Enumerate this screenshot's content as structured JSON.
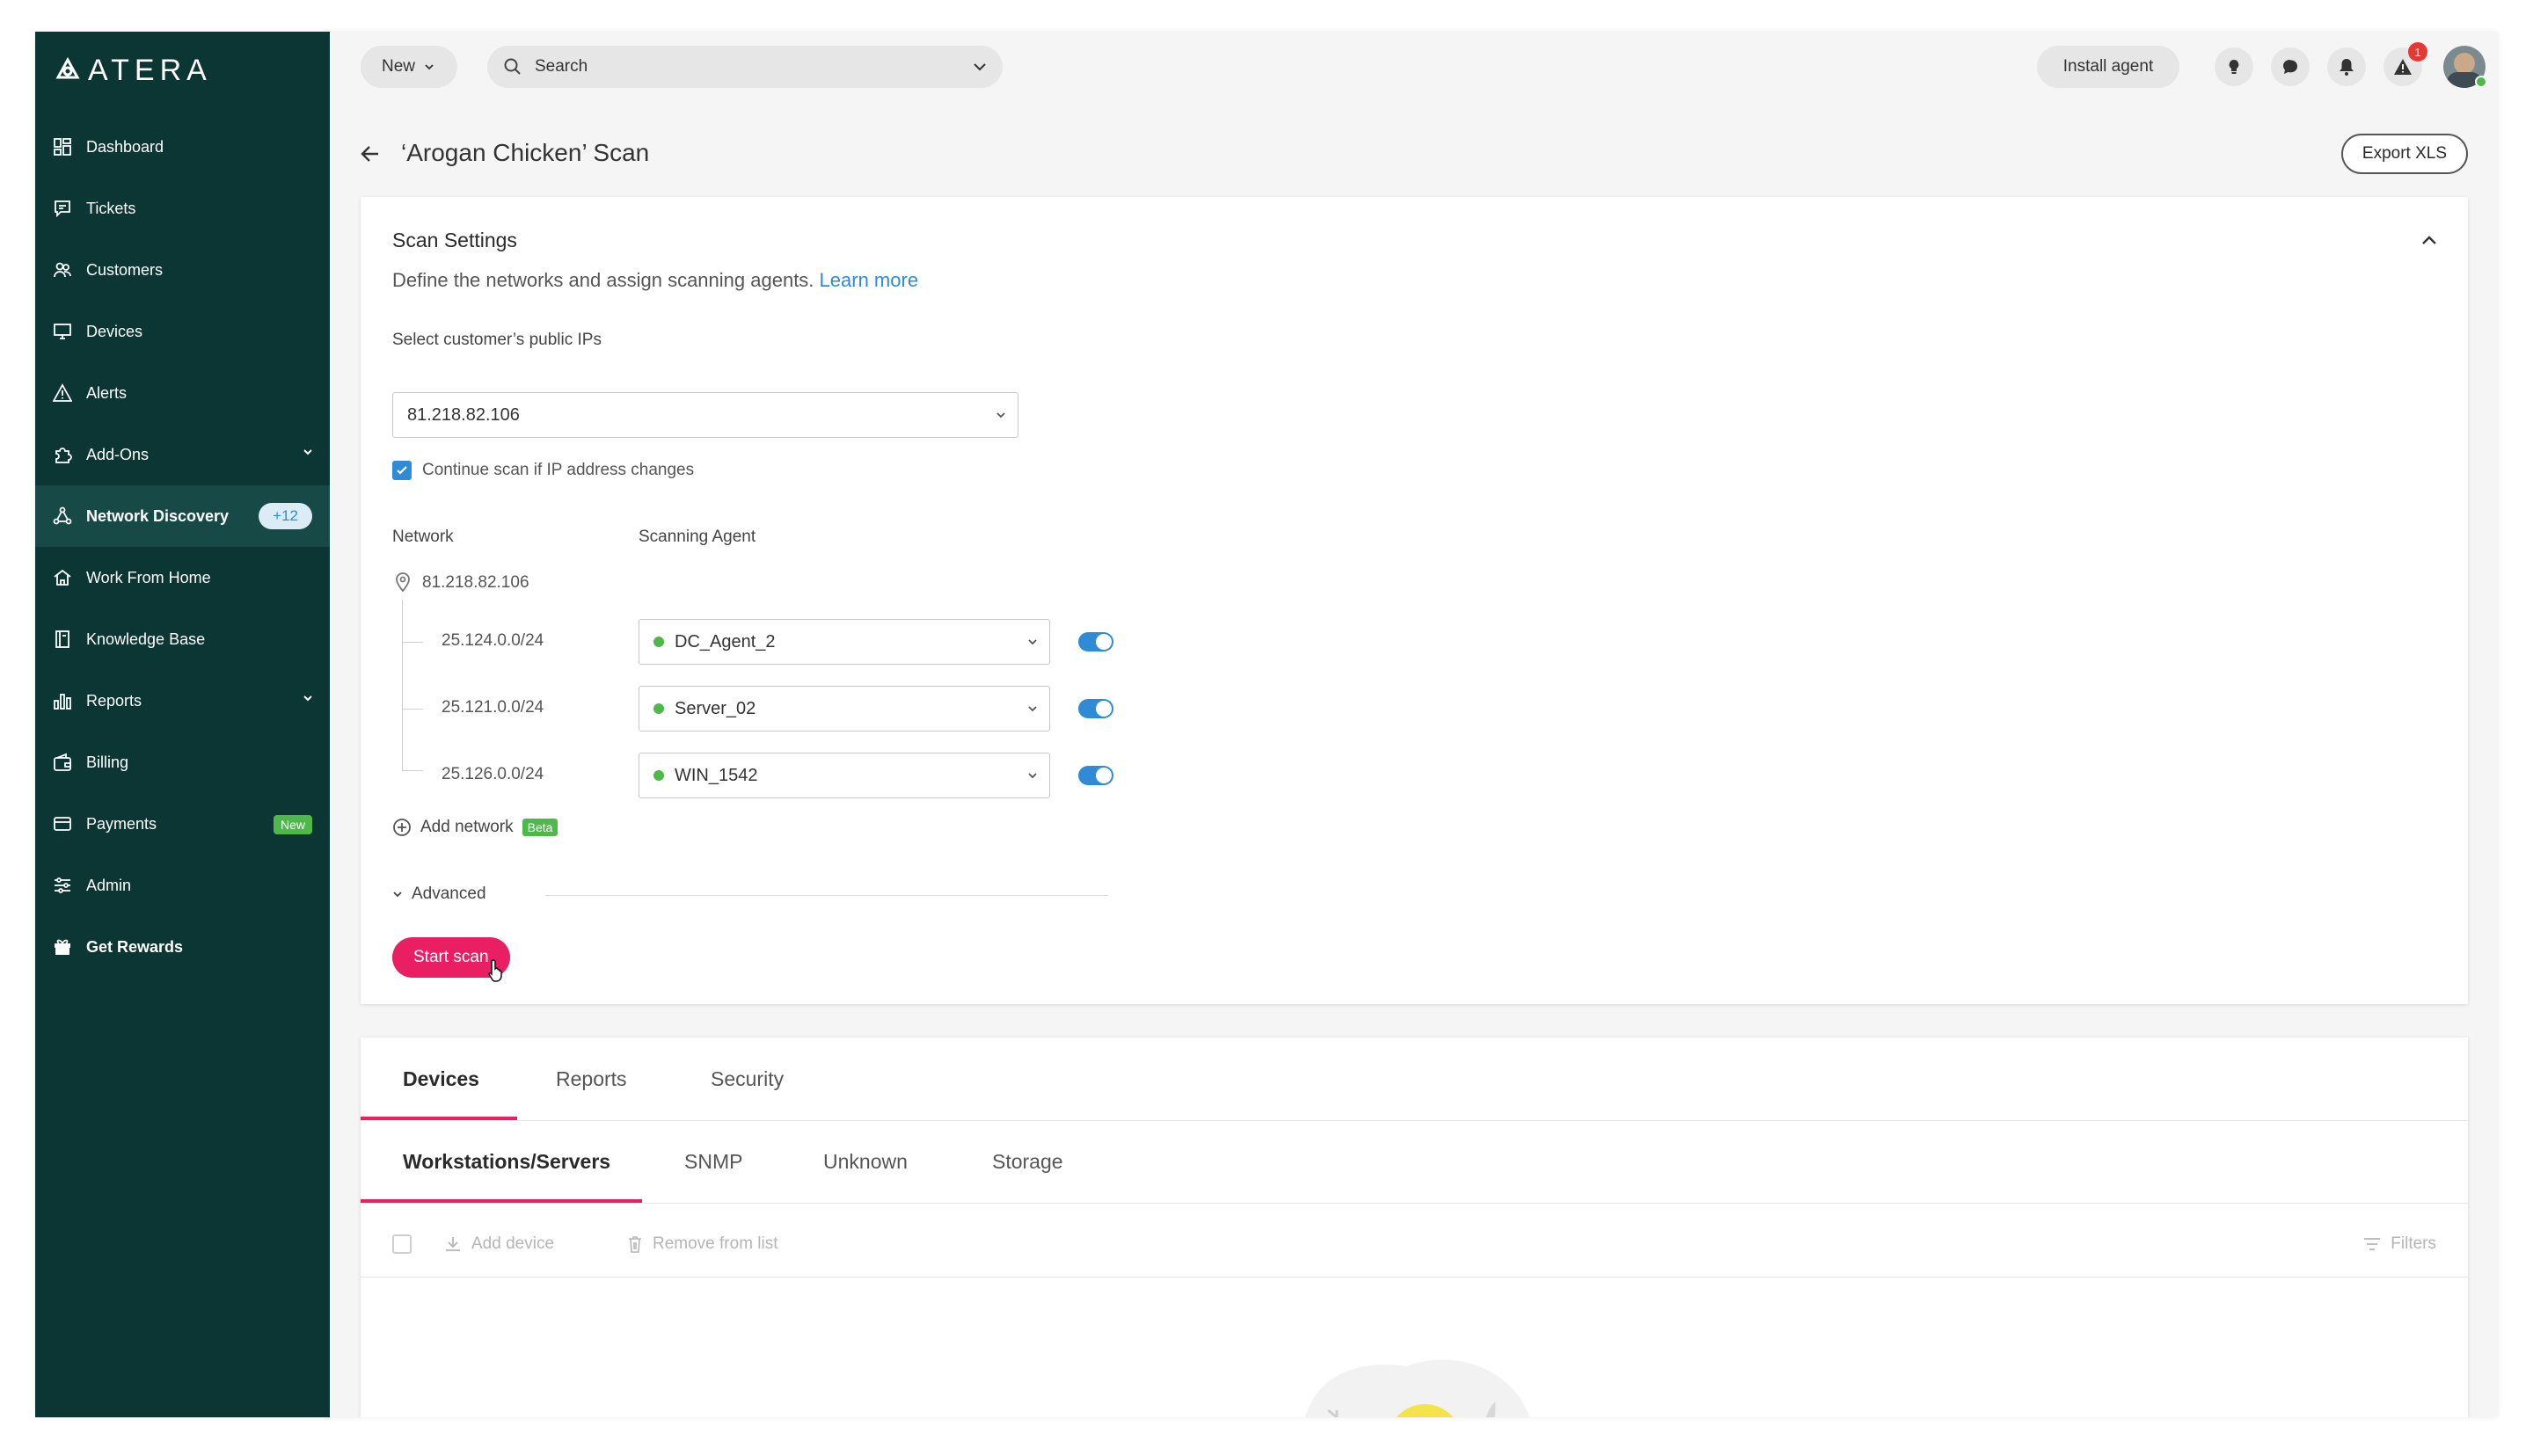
{
  "app": {
    "logo": "ATERA"
  },
  "sidebar": {
    "items": [
      {
        "label": "Dashboard"
      },
      {
        "label": "Tickets"
      },
      {
        "label": "Customers"
      },
      {
        "label": "Devices"
      },
      {
        "label": "Alerts"
      },
      {
        "label": "Add-Ons"
      },
      {
        "label": "Network Discovery",
        "badge": "+12"
      },
      {
        "label": "Work From Home"
      },
      {
        "label": "Knowledge Base"
      },
      {
        "label": "Reports"
      },
      {
        "label": "Billing"
      },
      {
        "label": "Payments",
        "badge": "New"
      },
      {
        "label": "Admin"
      },
      {
        "label": "Get Rewards"
      }
    ]
  },
  "topbar": {
    "new_label": "New",
    "search_placeholder": "Search",
    "install_agent": "Install agent",
    "alert_count": "1"
  },
  "page": {
    "title": "‘Arogan Chicken’ Scan",
    "export": "Export XLS"
  },
  "scan_settings": {
    "title": "Scan Settings",
    "description": "Define the networks and assign scanning agents.",
    "learn_more": "Learn more",
    "ip_label": "Select customer’s public IPs",
    "ip_value": "81.218.82.106",
    "continue_label": "Continue scan if IP address changes",
    "continue_checked": true,
    "network_header": "Network",
    "agent_header": "Scanning Agent",
    "root_ip": "81.218.82.106",
    "networks": [
      {
        "subnet": "25.124.0.0/24",
        "agent": "DC_Agent_2",
        "enabled": true
      },
      {
        "subnet": "25.121.0.0/24",
        "agent": "Server_02",
        "enabled": true
      },
      {
        "subnet": "25.126.0.0/24",
        "agent": "WIN_1542",
        "enabled": true
      }
    ],
    "add_network": "Add network",
    "beta": "Beta",
    "advanced": "Advanced",
    "start_scan": "Start scan"
  },
  "results": {
    "tabs": [
      "Devices",
      "Reports",
      "Security"
    ],
    "subtabs": [
      "Workstations/Servers",
      "SNMP",
      "Unknown",
      "Storage"
    ],
    "add_device": "Add device",
    "remove_from_list": "Remove from list",
    "filters": "Filters"
  }
}
